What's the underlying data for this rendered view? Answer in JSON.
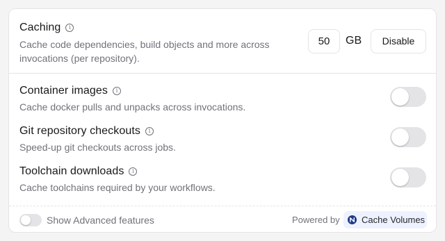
{
  "caching": {
    "title": "Caching",
    "description": "Cache code dependencies, build objects and more across invocations (per repository).",
    "size_value": "50",
    "size_unit": "GB",
    "disable_label": "Disable"
  },
  "features": [
    {
      "title": "Container images",
      "description": "Cache docker pulls and unpacks across invocations.",
      "enabled": false
    },
    {
      "title": "Git repository checkouts",
      "description": "Speed-up git checkouts across jobs.",
      "enabled": false
    },
    {
      "title": "Toolchain downloads",
      "description": "Cache toolchains required by your workflows.",
      "enabled": false
    }
  ],
  "footer": {
    "advanced_label": "Show Advanced features",
    "advanced_enabled": false,
    "powered_by": "Powered by",
    "badge_label": "Cache Volumes"
  },
  "icons": {
    "info": "info-icon",
    "badge": "cache-volumes-logo-icon"
  },
  "colors": {
    "toggle_off": "#e4e4e7",
    "badge_bg": "#eef2ff",
    "badge_icon": "#1e3a8a"
  }
}
